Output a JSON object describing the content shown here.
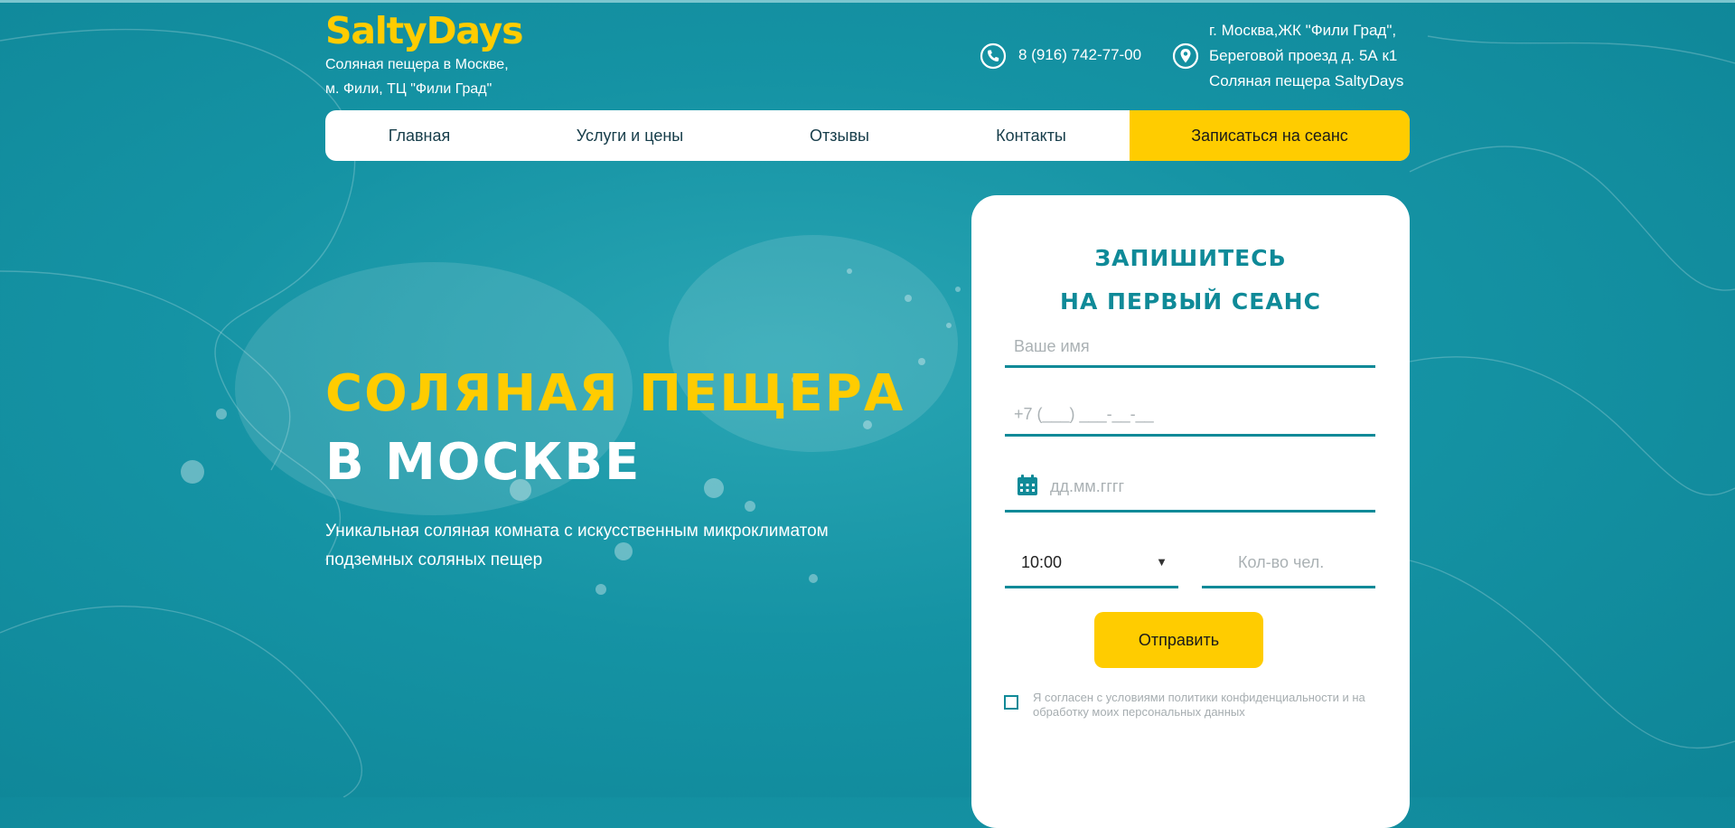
{
  "brand": {
    "logo": "SaltyDays",
    "tagline_line1": "Соляная пещера в Москве,",
    "tagline_line2": "м. Фили, ТЦ \"Фили Град\""
  },
  "contacts": {
    "phone": "8 (916) 742-77-00",
    "address_line1": "г. Москва,ЖК \"Фили Град\",",
    "address_line2": "Береговой проезд д. 5А к1",
    "address_line3": "Соляная пещера SaltyDays"
  },
  "nav": {
    "items": [
      {
        "label": "Главная"
      },
      {
        "label": "Услуги и цены"
      },
      {
        "label": "Отзывы"
      },
      {
        "label": "Контакты"
      }
    ],
    "cta_label": "Записаться на сеанс"
  },
  "hero": {
    "title_line1": "Соляная пещера",
    "title_line2": "в Москве",
    "subtitle": "Уникальная соляная комната с искусственным микроклиматом подземных соляных пещер"
  },
  "form": {
    "title_line1": "Запишитесь",
    "title_line2": "на первый сеанс",
    "name_placeholder": "Ваше имя",
    "phone_placeholder": "+7 (___) ___-__-__",
    "date_placeholder": "дд.мм.гггг",
    "time_value": "10:00",
    "count_placeholder": "Кол-во чел.",
    "submit_label": "Отправить",
    "consent_text": "Я согласен с условиями политики конфиденциальности и на обработку моих персональных данных"
  },
  "icons": {
    "phone": "phone-icon",
    "location": "location-pin-icon",
    "calendar": "calendar-icon",
    "dropdown": "chevron-down-icon"
  },
  "colors": {
    "accent": "#ffcc00",
    "primary": "#0f8a98",
    "background": "#1593a4",
    "nav_text": "#163d4a"
  }
}
